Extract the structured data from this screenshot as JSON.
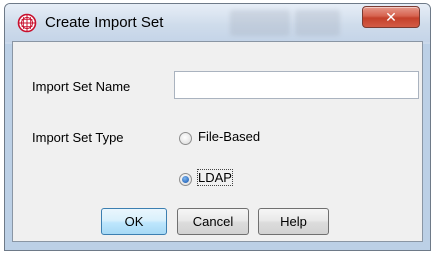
{
  "window": {
    "title": "Create Import Set",
    "close_glyph": "✕"
  },
  "form": {
    "name_label": "Import Set Name",
    "name_value": "",
    "type_label": "Import Set Type",
    "options": [
      {
        "label": "File-Based",
        "selected": false
      },
      {
        "label": "LDAP",
        "selected": true
      }
    ]
  },
  "buttons": {
    "ok": "OK",
    "cancel": "Cancel",
    "help": "Help"
  },
  "colors": {
    "icon_red": "#c8102e",
    "close_red": "#c4412b",
    "default_button": "#bee6fd"
  },
  "icons": {
    "app": "globe-grid-icon",
    "close": "close-icon"
  }
}
